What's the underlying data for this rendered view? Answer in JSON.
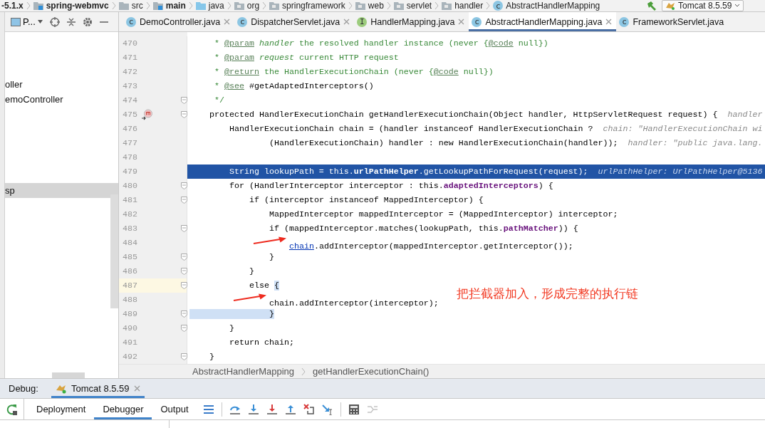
{
  "breadcrumbs": [
    {
      "label": "-5.1.x",
      "kind": "root"
    },
    {
      "label": "spring-webmvc",
      "kind": "module"
    },
    {
      "label": "src",
      "kind": "folder"
    },
    {
      "label": "main",
      "kind": "source"
    },
    {
      "label": "java",
      "kind": "sources"
    },
    {
      "label": "org",
      "kind": "package"
    },
    {
      "label": "springframework",
      "kind": "package"
    },
    {
      "label": "web",
      "kind": "package"
    },
    {
      "label": "servlet",
      "kind": "package"
    },
    {
      "label": "handler",
      "kind": "package"
    },
    {
      "label": "AbstractHandlerMapping",
      "kind": "class",
      "badge": "c"
    }
  ],
  "run_config": {
    "label": "Tomcat 8.5.59"
  },
  "project_panel": {
    "title": "P...",
    "items": [
      {
        "label": "oller",
        "selected": false
      },
      {
        "label": "emoController",
        "selected": false
      },
      {
        "label": "sp",
        "selected": true
      }
    ]
  },
  "tabs": [
    {
      "label": "DemoController.java",
      "kind": "class",
      "badge": "c",
      "selected": false,
      "closable": true
    },
    {
      "label": "DispatcherServlet.java",
      "kind": "class",
      "badge": "c",
      "selected": false,
      "closable": true
    },
    {
      "label": "HandlerMapping.java",
      "kind": "interface",
      "badge": "I",
      "selected": false,
      "closable": true
    },
    {
      "label": "AbstractHandlerMapping.java",
      "kind": "class",
      "badge": "c",
      "selected": true,
      "closable": true
    },
    {
      "label": "FrameworkServlet.java",
      "kind": "class",
      "badge": "c",
      "selected": false,
      "closable": false
    }
  ],
  "lines": [
    {
      "number": "470",
      "selected": false,
      "caret": false,
      "fold": false,
      "arrow": false,
      "marker": false,
      "code": [
        {
          "text": "     * ",
          "kind": "doc"
        },
        {
          "text": "@param",
          "kind": "tag"
        },
        {
          "text": " handler",
          "kind": "param"
        },
        {
          "text": " the resolved handler instance (never {",
          "kind": "doc"
        },
        {
          "text": "@code",
          "kind": "tag"
        },
        {
          "text": " null})",
          "kind": "doc"
        }
      ]
    },
    {
      "number": "471",
      "selected": false,
      "caret": false,
      "fold": false,
      "arrow": false,
      "marker": false,
      "code": [
        {
          "text": "     * ",
          "kind": "doc"
        },
        {
          "text": "@param",
          "kind": "tag"
        },
        {
          "text": " request",
          "kind": "param"
        },
        {
          "text": " current HTTP request",
          "kind": "doc"
        }
      ]
    },
    {
      "number": "472",
      "selected": false,
      "caret": false,
      "fold": false,
      "arrow": false,
      "marker": false,
      "code": [
        {
          "text": "     * ",
          "kind": "doc"
        },
        {
          "text": "@return",
          "kind": "tag"
        },
        {
          "text": " the HandlerExecutionChain (never {",
          "kind": "doc"
        },
        {
          "text": "@code",
          "kind": "tag"
        },
        {
          "text": " null})",
          "kind": "doc"
        }
      ]
    },
    {
      "number": "473",
      "selected": false,
      "caret": false,
      "fold": false,
      "arrow": false,
      "marker": false,
      "code": [
        {
          "text": "     * ",
          "kind": "doc"
        },
        {
          "text": "@see",
          "kind": "tag"
        },
        {
          "text": " #getAdaptedInterceptors()",
          "kind": "ref"
        }
      ]
    },
    {
      "number": "474",
      "selected": false,
      "caret": false,
      "fold": true,
      "arrow": false,
      "marker": false,
      "code": [
        {
          "text": "     */",
          "kind": "doc"
        }
      ]
    },
    {
      "number": "475",
      "selected": false,
      "caret": false,
      "fold": true,
      "arrow": false,
      "marker": true,
      "code": [
        {
          "text": "    protected",
          "kind": "keyword"
        },
        {
          "text": " HandlerExecutionChain getHandlerExecutionChain(Object handler, HttpServletRequest request) {",
          "kind": "plain"
        }
      ],
      "hint": "handler"
    },
    {
      "number": "476",
      "selected": false,
      "caret": false,
      "fold": false,
      "arrow": false,
      "marker": false,
      "code": [
        {
          "text": "        HandlerExecutionChain chain = (handler ",
          "kind": "plain"
        },
        {
          "text": "instanceof",
          "kind": "keyword"
        },
        {
          "text": " HandlerExecutionChain ?",
          "kind": "plain"
        }
      ],
      "hint": "chain: \"HandlerExecutionChain wi"
    },
    {
      "number": "477",
      "selected": false,
      "caret": false,
      "fold": false,
      "arrow": false,
      "marker": false,
      "code": [
        {
          "text": "                (HandlerExecutionChain) handler : ",
          "kind": "plain"
        },
        {
          "text": "new",
          "kind": "keyword"
        },
        {
          "text": " HandlerExecutionChain(handler));",
          "kind": "plain"
        }
      ],
      "hint": "handler: \"public java.lang."
    },
    {
      "number": "478",
      "selected": false,
      "caret": false,
      "fold": false,
      "arrow": false,
      "marker": false
    },
    {
      "number": "479",
      "selected": true,
      "caret": false,
      "fold": false,
      "arrow": false,
      "marker": false,
      "code": [
        {
          "text": "        String lookupPath = ",
          "kind": "plain"
        },
        {
          "text": "this",
          "kind": "keyword"
        },
        {
          "text": ".",
          "kind": "plain"
        },
        {
          "text": "urlPathHelper",
          "kind": "field"
        },
        {
          "text": ".getLookupPathForRequest(request);",
          "kind": "plain"
        }
      ],
      "hint": "urlPathHelper: UrlPathHelper@5136"
    },
    {
      "number": "480",
      "selected": false,
      "caret": false,
      "fold": true,
      "arrow": false,
      "marker": false,
      "code": [
        {
          "text": "        for",
          "kind": "keyword"
        },
        {
          "text": " (HandlerInterceptor interceptor : ",
          "kind": "plain"
        },
        {
          "text": "this",
          "kind": "keyword"
        },
        {
          "text": ".",
          "kind": "plain"
        },
        {
          "text": "adaptedInterceptors",
          "kind": "field"
        },
        {
          "text": ") {",
          "kind": "plain"
        }
      ]
    },
    {
      "number": "481",
      "selected": false,
      "caret": false,
      "fold": true,
      "arrow": false,
      "marker": false,
      "code": [
        {
          "text": "            if",
          "kind": "keyword"
        },
        {
          "text": " (interceptor ",
          "kind": "plain"
        },
        {
          "text": "instanceof",
          "kind": "keyword"
        },
        {
          "text": " MappedInterceptor) {",
          "kind": "plain"
        }
      ]
    },
    {
      "number": "482",
      "selected": false,
      "caret": false,
      "fold": false,
      "arrow": false,
      "marker": false,
      "code": [
        {
          "text": "                MappedInterceptor mappedInterceptor = (MappedInterceptor) interceptor;",
          "kind": "plain"
        }
      ]
    },
    {
      "number": "483",
      "selected": false,
      "caret": false,
      "fold": true,
      "arrow": false,
      "marker": false,
      "code": [
        {
          "text": "                if",
          "kind": "keyword"
        },
        {
          "text": " (mappedInterceptor.matches(lookupPath, ",
          "kind": "plain"
        },
        {
          "text": "this",
          "kind": "keyword"
        },
        {
          "text": ".",
          "kind": "plain"
        },
        {
          "text": "pathMatcher",
          "kind": "field"
        },
        {
          "text": ")) {",
          "kind": "plain"
        }
      ]
    },
    {
      "number": "484",
      "selected": false,
      "caret": false,
      "fold": false,
      "arrow": true,
      "marker": false,
      "code": [
        {
          "text": "                    chain",
          "kind": "link"
        },
        {
          "text": ".addInterceptor(mappedInterceptor.getInterceptor());",
          "kind": "plain"
        }
      ]
    },
    {
      "number": "485",
      "selected": false,
      "caret": false,
      "fold": true,
      "arrow": false,
      "marker": false,
      "code": [
        {
          "text": "                }",
          "kind": "plain"
        }
      ]
    },
    {
      "number": "486",
      "selected": false,
      "caret": false,
      "fold": true,
      "arrow": false,
      "marker": false,
      "code": [
        {
          "text": "            }",
          "kind": "plain"
        }
      ]
    },
    {
      "number": "487",
      "selected": false,
      "caret": true,
      "fold": true,
      "arrow": false,
      "marker": false,
      "code": [
        {
          "text": "            else ",
          "kind": "keyword"
        },
        {
          "text": "{",
          "kind": "brace"
        }
      ]
    },
    {
      "number": "488",
      "selected": false,
      "caret": false,
      "fold": false,
      "arrow": true,
      "marker": false,
      "code": [
        {
          "text": "                chain.addInterceptor(interceptor);",
          "kind": "plain"
        }
      ],
      "note": "把拦截器加入，形成完整的执行链"
    },
    {
      "number": "489",
      "selected": false,
      "caret": false,
      "fold": true,
      "arrow": false,
      "marker": false,
      "code": [
        {
          "text": "                }",
          "kind": "brace"
        }
      ]
    },
    {
      "number": "490",
      "selected": false,
      "caret": false,
      "fold": true,
      "arrow": false,
      "marker": false,
      "code": [
        {
          "text": "        }",
          "kind": "plain"
        }
      ]
    },
    {
      "number": "491",
      "selected": false,
      "caret": false,
      "fold": false,
      "arrow": false,
      "marker": false,
      "code": [
        {
          "text": "        return",
          "kind": "keyword"
        },
        {
          "text": " chain;",
          "kind": "plain"
        }
      ]
    },
    {
      "number": "492",
      "selected": false,
      "caret": false,
      "fold": true,
      "arrow": false,
      "marker": false,
      "code": [
        {
          "text": "    }",
          "kind": "plain"
        }
      ]
    }
  ],
  "editor_breadcrumbs": [
    "AbstractHandlerMapping",
    "getHandlerExecutionChain()"
  ],
  "debug": {
    "title": "Debug:",
    "session": {
      "label": "Tomcat 8.5.59",
      "selected": true
    },
    "tabs": [
      {
        "label": "Deployment",
        "selected": false
      },
      {
        "label": "Debugger",
        "selected": true
      },
      {
        "label": "Output",
        "selected": false
      }
    ],
    "tools": [
      {
        "kind": "menu",
        "disabled": false
      },
      {
        "kind": "stepover",
        "disabled": false
      },
      {
        "kind": "stepinto",
        "disabled": false
      },
      {
        "kind": "forceinto",
        "disabled": false
      },
      {
        "kind": "stepout",
        "disabled": false
      },
      {
        "kind": "dropframe",
        "disabled": false
      },
      {
        "kind": "runcursor",
        "disabled": false
      },
      {
        "kind": "evaluate",
        "disabled": false
      },
      {
        "kind": "trace",
        "disabled": true
      }
    ]
  }
}
